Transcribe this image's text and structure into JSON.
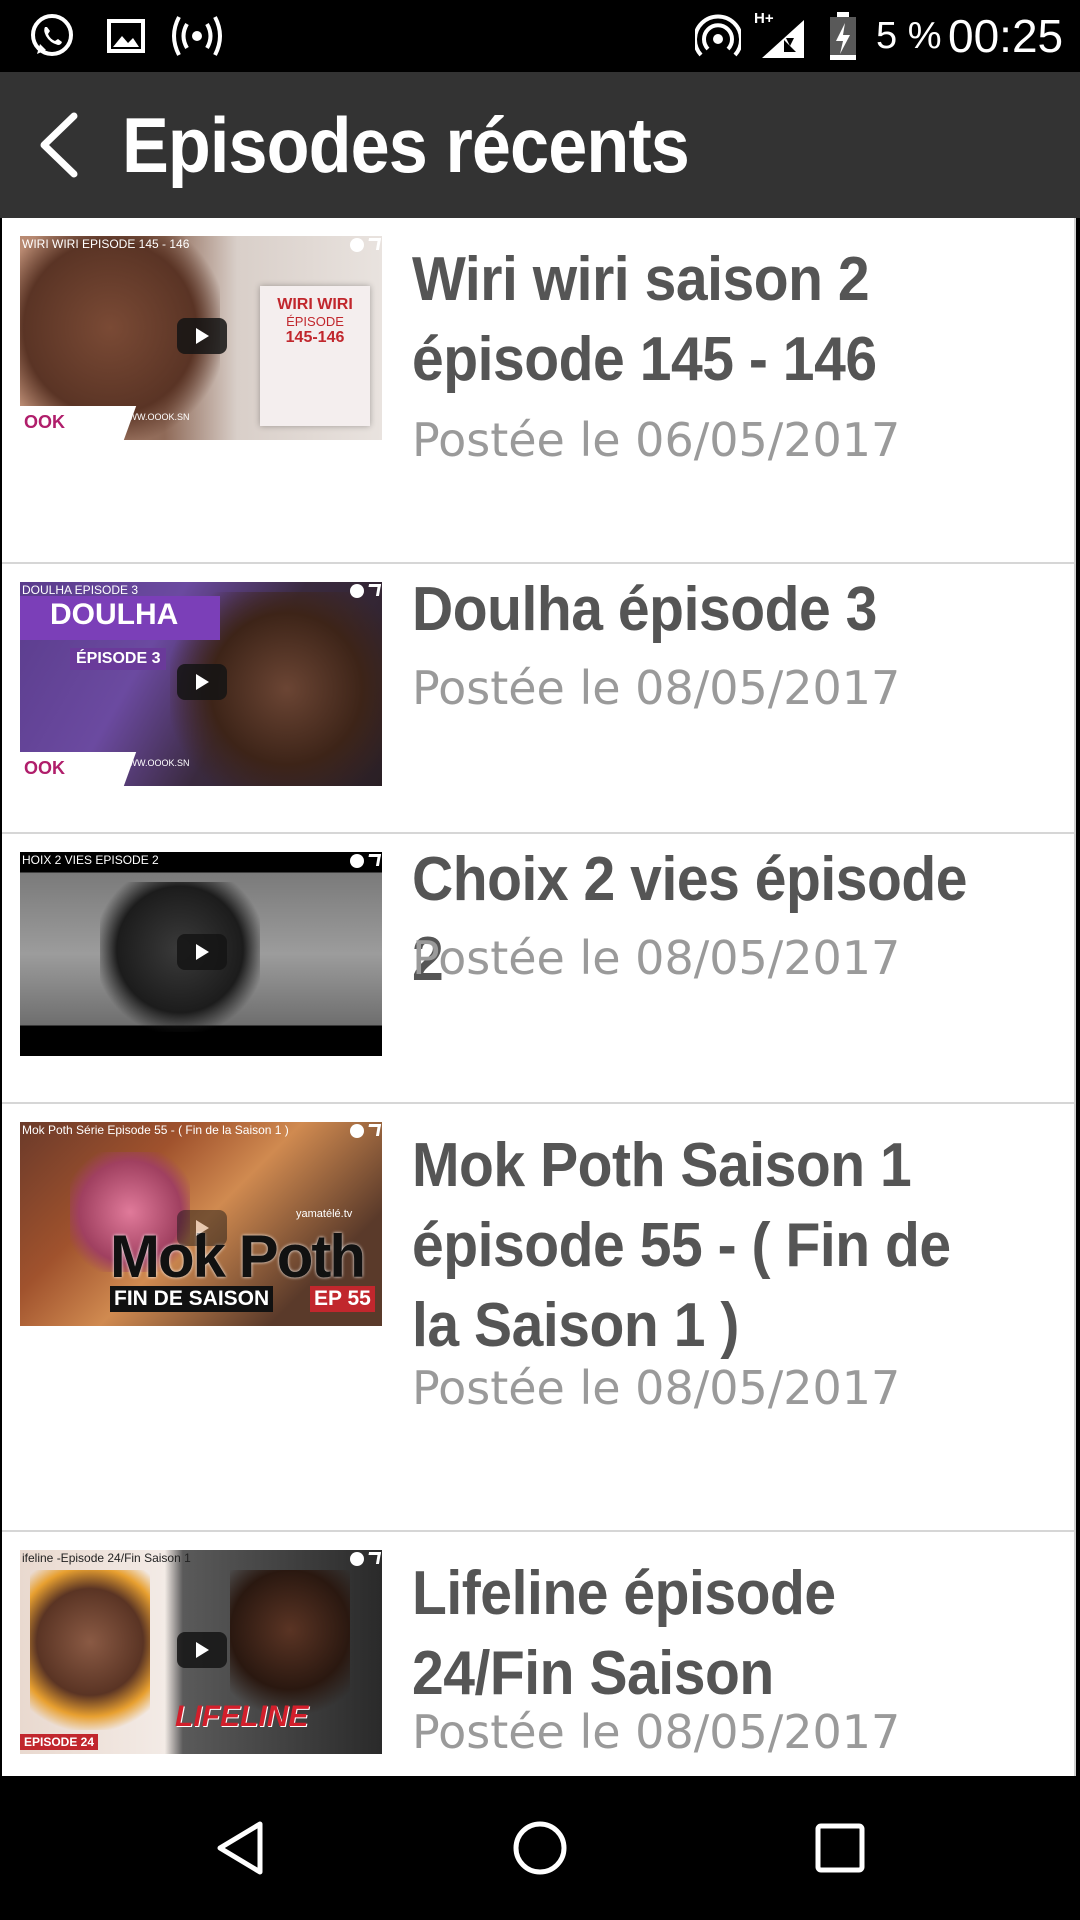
{
  "status_bar": {
    "icons": [
      "whatsapp-icon",
      "gallery-icon",
      "hotspot-icon",
      "wifi-tethering-icon",
      "signal-hplus-icon",
      "battery-charging-icon"
    ],
    "network_type": "H+",
    "battery": "5 %",
    "time": "00:25"
  },
  "app_bar": {
    "back_icon": "back-arrow-icon",
    "title": "Episodes récents"
  },
  "episodes": [
    {
      "title": "Wiri wiri saison 2 épisode 145 - 146",
      "date": "Postée le 06/05/2017",
      "thumb_caption": "WIRI WIRI EPISODE 145 - 146",
      "thumb_text": "WIRI WIRI",
      "thumb_sub": "ÉPISODE",
      "thumb_num": "145-146",
      "thumb_site": "WWW.OOOK.SN",
      "thumb_logo": "OOK"
    },
    {
      "title": "Doulha épisode 3",
      "date": "Postée le 08/05/2017",
      "thumb_caption": "DOULHA EPISODE 3",
      "thumb_text": "DOULHA",
      "thumb_sub": "ÉPISODE 3",
      "thumb_site": "WWW.OOOK.SN",
      "thumb_logo": "OOK"
    },
    {
      "title": "Choix 2 vies épisode 2",
      "date": "Postée le 08/05/2017",
      "thumb_caption": "HOIX 2 VIES EPISODE 2"
    },
    {
      "title": "Mok Poth Saison 1 épisode 55 - ( Fin de la Saison 1 )",
      "date": "Postée le 08/05/2017",
      "thumb_caption": "Mok Poth Série Episode 55 - ( Fin de la Saison 1 )",
      "thumb_text": "Mok Poth",
      "thumb_sub": "FIN DE SAISON",
      "thumb_num": "EP 55",
      "thumb_site": "yamatélé.tv"
    },
    {
      "title": "Lifeline épisode 24/Fin Saison",
      "date": "Postée le 08/05/2017",
      "thumb_caption": "ifeline -Episode 24/Fin Saison 1",
      "thumb_text": "LIFELINE",
      "thumb_sub": "EPISODE 24"
    }
  ],
  "nav_bar": {
    "back": "nav-back-icon",
    "home": "nav-home-icon",
    "recents": "nav-recents-icon"
  },
  "colors": {
    "app_bar": "#333333",
    "title_text": "#555555",
    "date_text": "#9a9a9a",
    "divider": "#d6d6d6"
  }
}
